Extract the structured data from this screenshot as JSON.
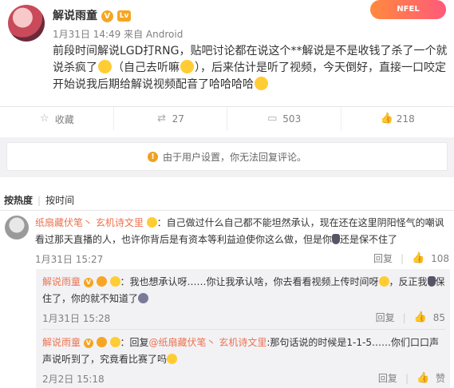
{
  "post": {
    "author": "解说雨童",
    "verified_badge": "V",
    "level_badge": "Lv",
    "meta": "1月31日 14:49 来自 Android",
    "banner": "NFEL",
    "text_1": "前段时间解说LGD打RNG，贴吧讨论都在说这个**解说是不是收钱了杀了一个就说杀疯了",
    "text_2": "（自己去听嘛",
    "text_3": "），后来估计是听了视频，今天倒好，直接一口咬定开始说我后期给解说视频配音了哈哈哈哈"
  },
  "actions": {
    "favorite": "收藏",
    "repost": "27",
    "comment": "503",
    "like": "218"
  },
  "notice": "由于用户设置，你无法回复评论。",
  "sort": {
    "hot": "按热度",
    "time": "按时间"
  },
  "comment1": {
    "author": "纸扇藏伏笔丶 玄机诗文里",
    "text_1": "：自己做过什么自己都不能坦然承认，现在还在这里阴阳怪气的嘲讽看过那天直播的人，也许你背后是有资本等利益迫使你这么做，但是你",
    "text_2": "还是保不住了",
    "time": "1月31日 15:27",
    "reply": "回复",
    "likes": "108"
  },
  "reply1": {
    "author": "解说雨童",
    "text_1": "：我也想承认呀……你让我承认啥，你去看看视频上传时间呀",
    "text_2": "，反正我",
    "text_3": "保住了，你的就不知道了",
    "time": "1月31日 15:28",
    "reply": "回复",
    "likes": "85"
  },
  "reply2": {
    "author": "解说雨童",
    "text_1": "：回复",
    "mention": "@纸扇藏伏笔丶 玄机诗文里",
    "text_2": ":那句话说的时候是1-1-5……你们口口声声说听到了，究竟看比赛了吗",
    "time": "2月2日 15:18",
    "reply": "回复",
    "likes": "赞"
  }
}
